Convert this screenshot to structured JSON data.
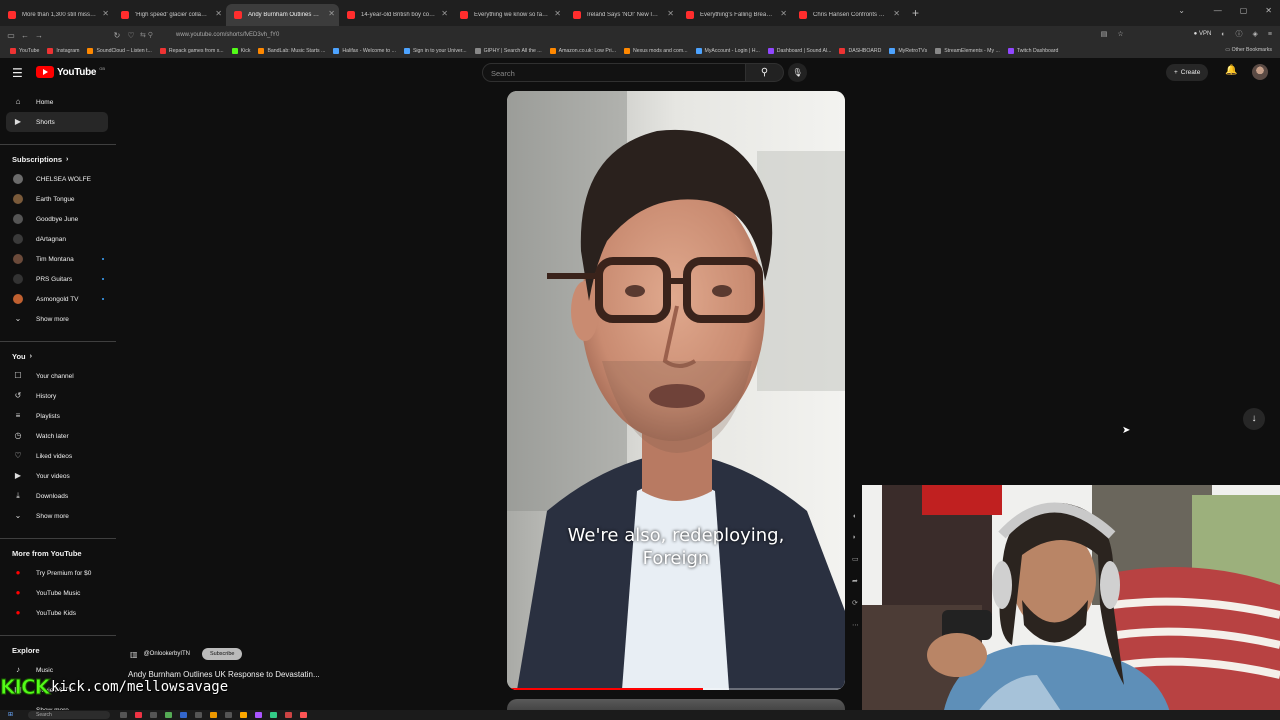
{
  "browser": {
    "tabs": [
      {
        "label": "More than 1,300 still missing af..."
      },
      {
        "label": "'High speed' glacier collapse co..."
      },
      {
        "label": "Andy Burnham Outlines UK Re..."
      },
      {
        "label": "14-year-old British boy confir..."
      },
      {
        "label": "Everything we know so far abo..."
      },
      {
        "label": "Ireland Says 'NO!' New IRA To I..."
      },
      {
        "label": "Everything's Falling Breakdown"
      },
      {
        "label": "Chris Hansen Confronts EDP44..."
      }
    ],
    "new_tab_glyph": "+",
    "url": "www.youtube.com/shorts/fvED3vh_fY0",
    "vpn_label": "VPN",
    "bookmarks": [
      {
        "label": "YouTube"
      },
      {
        "label": "Instagram"
      },
      {
        "label": "SoundCloud – Listen t..."
      },
      {
        "label": "Repack games from x..."
      },
      {
        "label": "Kick"
      },
      {
        "label": "BandLab: Music Starts ..."
      },
      {
        "label": "Halifax - Welcome to ..."
      },
      {
        "label": "Sign in to your Univer..."
      },
      {
        "label": "GIPHY | Search All the ..."
      },
      {
        "label": "Amazon.co.uk: Low Pri..."
      },
      {
        "label": "Nexus mods and com..."
      },
      {
        "label": "MyAccount - Login | H..."
      },
      {
        "label": "Dashboard | Sound Al..."
      },
      {
        "label": "DASHBOARD"
      },
      {
        "label": "MyRetroTVs"
      },
      {
        "label": "StreamElements - My ..."
      },
      {
        "label": "Twitch Dashboard"
      }
    ],
    "other_bookmarks": "Other Bookmarks"
  },
  "youtube": {
    "logo_text": "YouTube",
    "logo_country": "GB",
    "search_placeholder": "Search",
    "create_label": "Create",
    "sidebar": {
      "primary": [
        {
          "label": "Home",
          "icon": "home-icon"
        },
        {
          "label": "Shorts",
          "icon": "shorts-icon"
        }
      ],
      "subscriptions_title": "Subscriptions",
      "subscriptions": [
        {
          "label": "CHELSEA WOLFE",
          "live": false
        },
        {
          "label": "Earth Tongue",
          "live": false
        },
        {
          "label": "Goodbye June",
          "live": false
        },
        {
          "label": "dArtagnan",
          "live": false
        },
        {
          "label": "Tim Montana",
          "live": true
        },
        {
          "label": "PRS Guitars",
          "live": true
        },
        {
          "label": "Asmongold TV",
          "live": true
        }
      ],
      "show_more_1": "Show more",
      "you_title": "You",
      "you_items": [
        {
          "label": "Your channel",
          "icon": "channel-icon"
        },
        {
          "label": "History",
          "icon": "history-icon"
        },
        {
          "label": "Playlists",
          "icon": "playlists-icon"
        },
        {
          "label": "Watch later",
          "icon": "watch-later-icon"
        },
        {
          "label": "Liked videos",
          "icon": "like-icon"
        },
        {
          "label": "Your videos",
          "icon": "your-videos-icon"
        },
        {
          "label": "Downloads",
          "icon": "download-icon"
        }
      ],
      "show_more_2": "Show more",
      "more_title": "More from YouTube",
      "more_items": [
        {
          "label": "Try Premium for $0"
        },
        {
          "label": "YouTube Music"
        },
        {
          "label": "YouTube Kids"
        }
      ],
      "explore_title": "Explore",
      "explore_items": [
        {
          "label": "Music",
          "icon": "music-icon"
        },
        {
          "label": "Movies & TV",
          "icon": "movies-icon"
        },
        {
          "label": "Show more",
          "icon": "chevron-down-icon"
        }
      ]
    },
    "short": {
      "caption_line1": "We're also, redeploying,",
      "caption_line2": "Foreign",
      "channel_handle": "@OnlookerbyITN",
      "subscribe_label": "Subscribe",
      "title": "Andy Burnham Outlines UK Response to Devastatin...",
      "progress_fraction": 0.58
    }
  },
  "overlay": {
    "kick_logo": "KICK",
    "kick_url": "kick.com/mellowsavage"
  },
  "taskbar": {
    "search_label": "Search"
  },
  "colors": {
    "youtube_red": "#ff0000",
    "kick_green": "#53fc18",
    "background": "#0f0f0f"
  }
}
